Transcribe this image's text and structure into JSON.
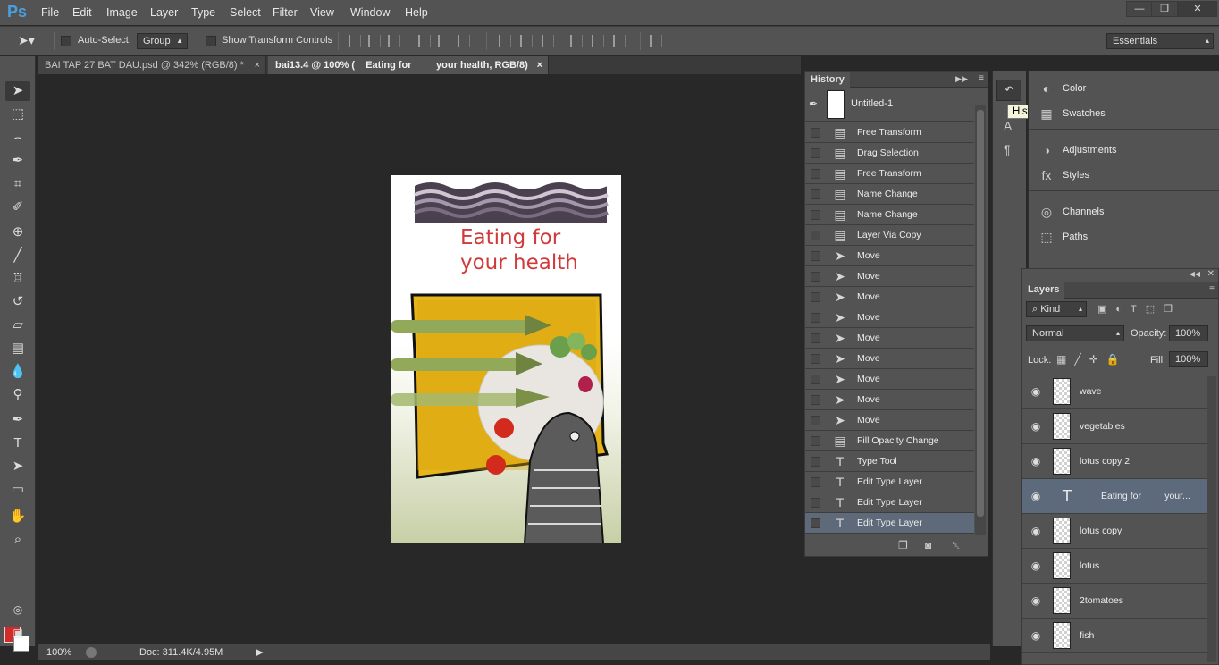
{
  "app": {
    "logo": "Ps"
  },
  "menu": [
    "File",
    "Edit",
    "Image",
    "Layer",
    "Type",
    "Select",
    "Filter",
    "View",
    "Window",
    "Help"
  ],
  "window_controls": {
    "minimize": "—",
    "restore": "❐",
    "close": "✕"
  },
  "options": {
    "auto_select_label": "Auto-Select:",
    "auto_select_value": "Group",
    "show_transform_label": "Show Transform Controls",
    "workspace": "Essentials"
  },
  "tabs": [
    {
      "label": "BAI TAP 27 BAT DAU.psd @ 342% (RGB/8) *",
      "close": "×"
    },
    {
      "label": "bai13.4 @ 100% (    Eating for         your health, RGB/8)",
      "close": "×"
    }
  ],
  "canvas": {
    "title_line1": "Eating for",
    "title_line2": "your health"
  },
  "status": {
    "zoom": "100%",
    "doc": "Doc: 311.4K/4.95M"
  },
  "history": {
    "title": "History",
    "snapshot": "Untitled-1",
    "items": [
      {
        "label": "Free Transform",
        "icon": "doc-icon"
      },
      {
        "label": "Drag Selection",
        "icon": "doc-icon"
      },
      {
        "label": "Free Transform",
        "icon": "doc-icon"
      },
      {
        "label": "Name Change",
        "icon": "doc-icon"
      },
      {
        "label": "Name Change",
        "icon": "doc-icon"
      },
      {
        "label": "Layer Via Copy",
        "icon": "doc-icon"
      },
      {
        "label": "Move",
        "icon": "move-icon"
      },
      {
        "label": "Move",
        "icon": "move-icon"
      },
      {
        "label": "Move",
        "icon": "move-icon"
      },
      {
        "label": "Move",
        "icon": "move-icon"
      },
      {
        "label": "Move",
        "icon": "move-icon"
      },
      {
        "label": "Move",
        "icon": "move-icon"
      },
      {
        "label": "Move",
        "icon": "move-icon"
      },
      {
        "label": "Move",
        "icon": "move-icon"
      },
      {
        "label": "Move",
        "icon": "move-icon"
      },
      {
        "label": "Fill Opacity Change",
        "icon": "doc-icon"
      },
      {
        "label": "Type Tool",
        "icon": "type-icon"
      },
      {
        "label": "Edit Type Layer",
        "icon": "type-icon"
      },
      {
        "label": "Edit Type Layer",
        "icon": "type-icon"
      },
      {
        "label": "Edit Type Layer",
        "icon": "type-icon"
      }
    ]
  },
  "tooltip": "History",
  "right_panels": {
    "color": "Color",
    "swatches": "Swatches",
    "adjustments": "Adjustments",
    "styles": "Styles",
    "channels": "Channels",
    "paths": "Paths"
  },
  "layers": {
    "title": "Layers",
    "kind": "Kind",
    "blend_mode": "Normal",
    "opacity_label": "Opacity:",
    "opacity": "100%",
    "lock_label": "Lock:",
    "fill_label": "Fill:",
    "fill": "100%",
    "items": [
      {
        "name": "wave",
        "type": "image"
      },
      {
        "name": "vegetables",
        "type": "image"
      },
      {
        "name": "lotus copy 2",
        "type": "image"
      },
      {
        "name": "Eating for         your...",
        "type": "text"
      },
      {
        "name": "lotus copy",
        "type": "image"
      },
      {
        "name": "lotus",
        "type": "image"
      },
      {
        "name": "2tomatoes",
        "type": "image"
      },
      {
        "name": "fish",
        "type": "image"
      }
    ]
  },
  "colors": {
    "foreground": "#d32a2a",
    "background": "#ffffff",
    "title_red": "#d13a3a"
  }
}
